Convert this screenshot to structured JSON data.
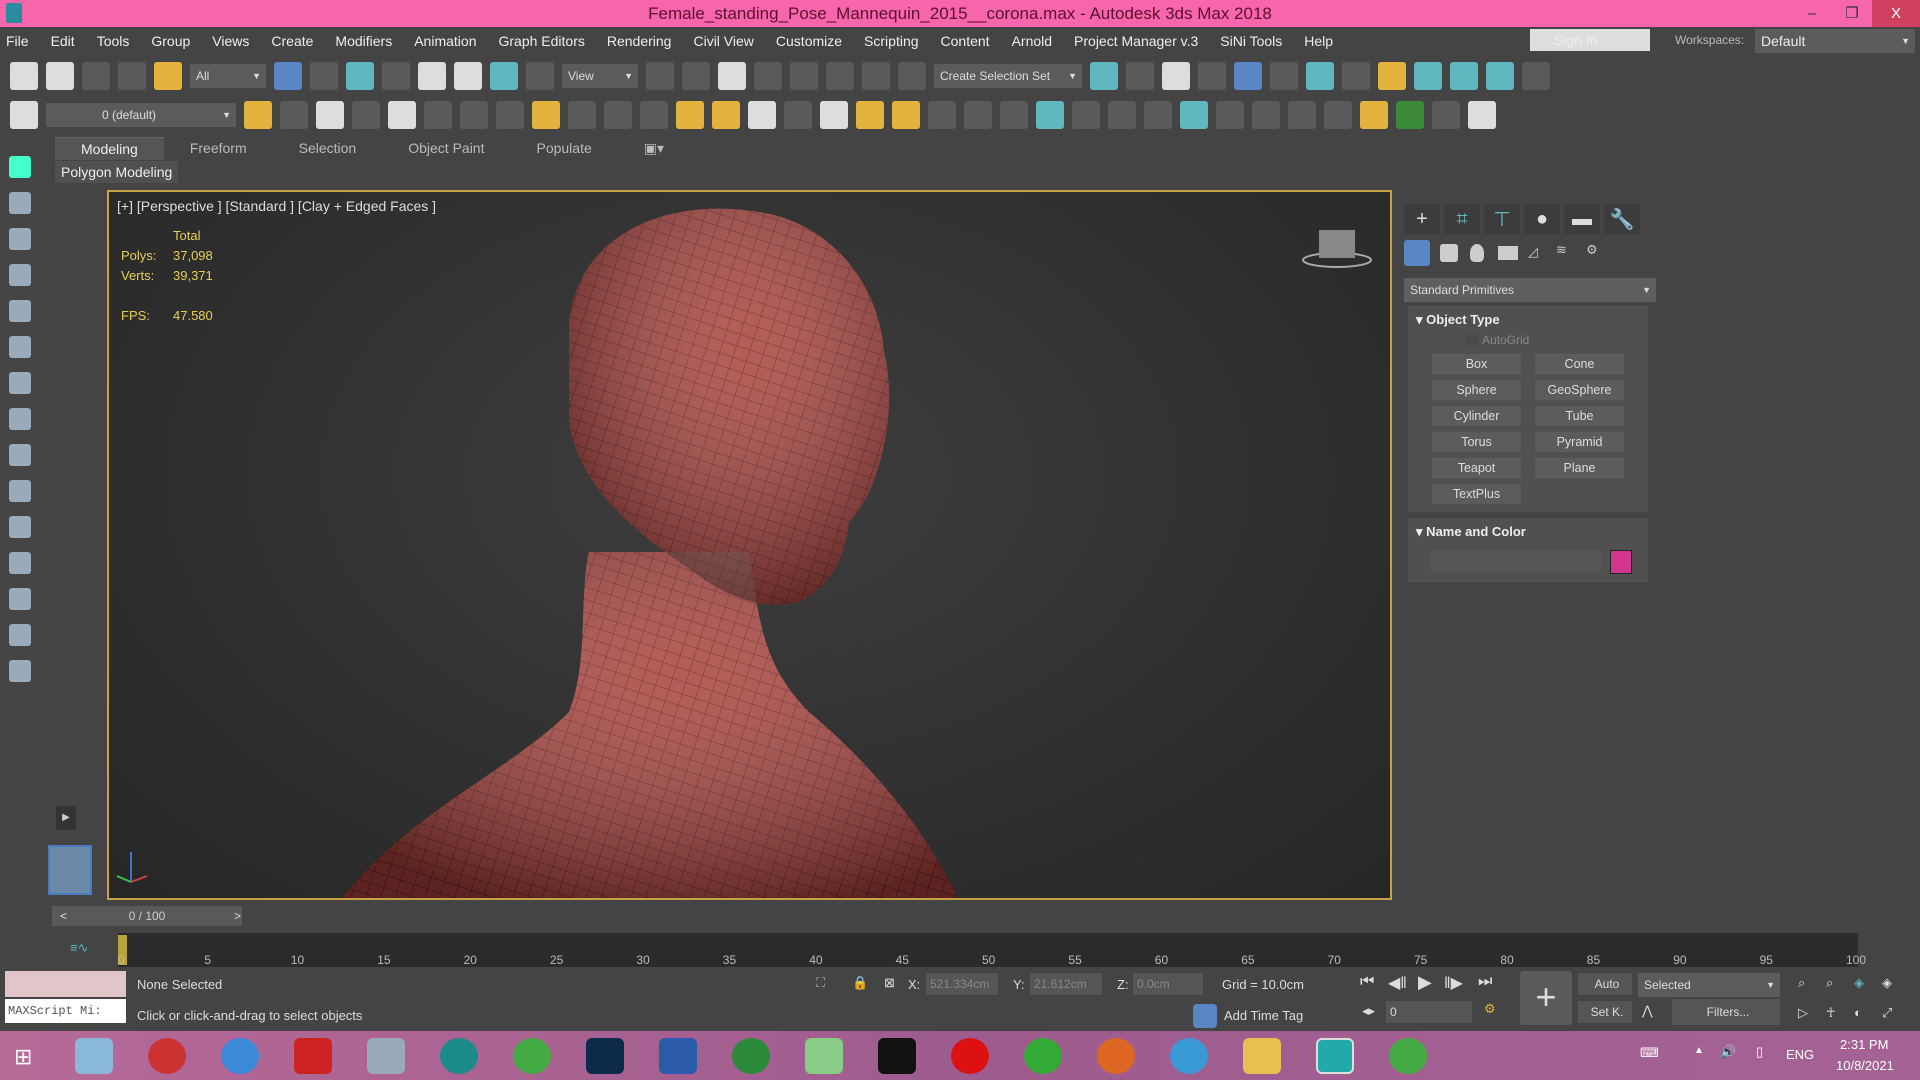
{
  "window": {
    "title": "Female_standing_Pose_Mannequin_2015__corona.max - Autodesk 3ds Max 2018",
    "minimize": "–",
    "maximize": "❐",
    "close": "X"
  },
  "menu": [
    "File",
    "Edit",
    "Tools",
    "Group",
    "Views",
    "Create",
    "Modifiers",
    "Animation",
    "Graph Editors",
    "Rendering",
    "Civil View",
    "Customize",
    "Scripting",
    "Content",
    "Arnold",
    "Project Manager v.3",
    "SiNi Tools",
    "Help"
  ],
  "account": {
    "sign_in": "Sign In",
    "workspaces_label": "Workspaces:",
    "workspace": "Default"
  },
  "toolbar": {
    "filter": "All",
    "ref_coord": "View",
    "selection_set": "Create Selection Set",
    "layer": "0 (default)"
  },
  "ribbon": {
    "tabs": [
      "Modeling",
      "Freeform",
      "Selection",
      "Object Paint",
      "Populate"
    ],
    "panel": "Polygon Modeling"
  },
  "viewport": {
    "label": "[+] [Perspective ] [Standard ] [Clay + Edged Faces ]",
    "stats_header": "Total",
    "polys_label": "Polys:",
    "polys": "37,098",
    "verts_label": "Verts:",
    "verts": "39,371",
    "fps_label": "FPS:",
    "fps": "47.580"
  },
  "command_panel": {
    "category": "Standard Primitives",
    "object_type_title": "Object Type",
    "autogrid": "AutoGrid",
    "buttons": [
      "Box",
      "Cone",
      "Sphere",
      "GeoSphere",
      "Cylinder",
      "Tube",
      "Torus",
      "Pyramid",
      "Teapot",
      "Plane",
      "TextPlus"
    ],
    "name_color_title": "Name and Color",
    "object_color": "#d0358f"
  },
  "timeline": {
    "frame": "0 / 100",
    "prev": "<",
    "next": ">",
    "ticks": [
      "0",
      "5",
      "10",
      "15",
      "20",
      "25",
      "30",
      "35",
      "40",
      "45",
      "50",
      "55",
      "60",
      "65",
      "70",
      "75",
      "80",
      "85",
      "90",
      "95",
      "100"
    ]
  },
  "status": {
    "maxscript": "MAXScript Mi:",
    "selection": "None Selected",
    "prompt": "Click or click-and-drag to select objects",
    "x_label": "X:",
    "x": "521.334cm",
    "y_label": "Y:",
    "y": "21.612cm",
    "z_label": "Z:",
    "z": "0.0cm",
    "grid": "Grid = 10.0cm",
    "add_time_tag": "Add Time Tag",
    "auto": "Auto",
    "set_key": "Set K.",
    "key_filter": "Selected",
    "filters": "Filters...",
    "current_frame": "0"
  },
  "taskbar": {
    "lang": "ENG",
    "time": "2:31 PM",
    "date": "10/8/2021"
  }
}
